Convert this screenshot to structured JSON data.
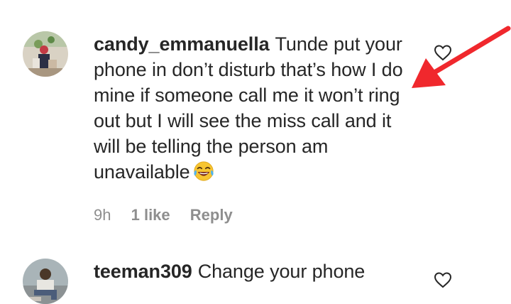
{
  "comments": [
    {
      "username": "candy_emmanuella",
      "text": "Tunde put your phone in don’t disturb that’s how I do mine if someone call me it won’t ring out but I will see the miss call and it will be telling the person am unavailable",
      "emoji": "face-with-tears-of-joy",
      "time": "9h",
      "likes": "1 like",
      "reply_label": "Reply"
    },
    {
      "username": "teeman309",
      "text": "Change your phone"
    }
  ],
  "colors": {
    "text": "#262626",
    "muted": "#8e8e8e",
    "annotation_arrow": "#f0282d"
  },
  "icons": {
    "like": "heart-outline-icon",
    "annotation": "red-arrow"
  }
}
